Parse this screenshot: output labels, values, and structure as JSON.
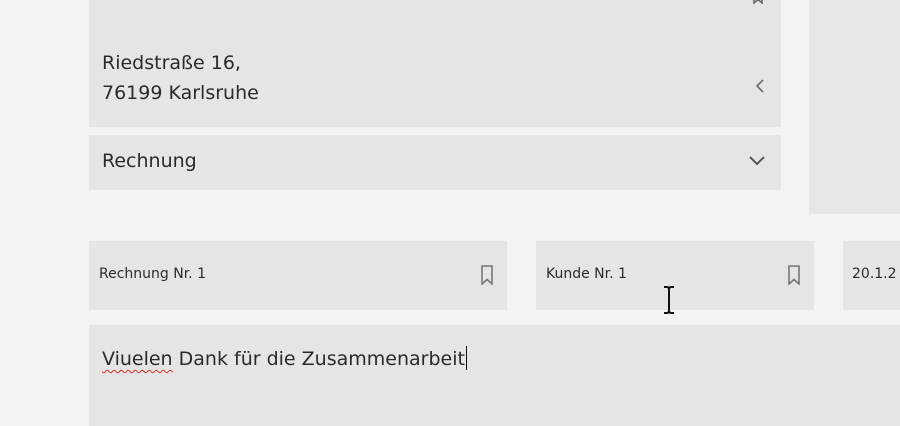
{
  "address": {
    "street": "Riedstraße 16,",
    "city": "76199 Karlsruhe"
  },
  "document_type": {
    "selected": "Rechnung"
  },
  "fields": {
    "invoice_number": "Rechnung Nr. 1",
    "customer_number": "Kunde Nr. 1",
    "date": "20.1.2"
  },
  "message": {
    "misspelled_word": "Viuelen",
    "rest": " Dank für die Zusammenarbeit"
  },
  "icons": {
    "bookmark": "bookmark-icon",
    "chevron_left": "chevron-left-icon",
    "chevron_down": "chevron-down-icon",
    "text_cursor": "text-cursor-icon"
  },
  "colors": {
    "background": "#f3f3f3",
    "panel": "#e5e5e5",
    "text": "#2b2b2b",
    "spellcheck": "#d9302c"
  }
}
